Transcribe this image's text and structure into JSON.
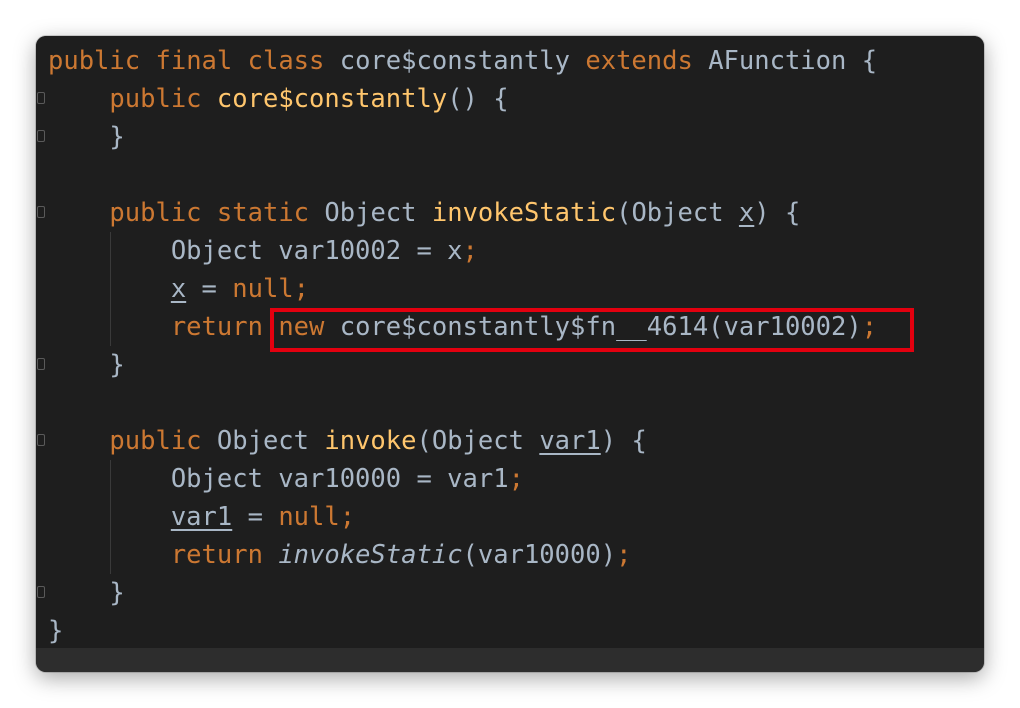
{
  "editor": {
    "lines": [
      [
        {
          "t": "public",
          "c": "kw"
        },
        {
          "t": " "
        },
        {
          "t": "final",
          "c": "kw"
        },
        {
          "t": " "
        },
        {
          "t": "class",
          "c": "kw"
        },
        {
          "t": " core$constantly "
        },
        {
          "t": "extends",
          "c": "kw"
        },
        {
          "t": " AFunction {"
        }
      ],
      [
        {
          "t": "    "
        },
        {
          "t": "public",
          "c": "kw"
        },
        {
          "t": " "
        },
        {
          "t": "core$constantly",
          "c": "fn"
        },
        {
          "t": "() {"
        }
      ],
      [
        {
          "t": "    }"
        }
      ],
      [],
      [
        {
          "t": "    "
        },
        {
          "t": "public",
          "c": "kw"
        },
        {
          "t": " "
        },
        {
          "t": "static",
          "c": "kw"
        },
        {
          "t": " Object "
        },
        {
          "t": "invokeStatic",
          "c": "fn"
        },
        {
          "t": "(Object "
        },
        {
          "t": "x",
          "c": "ul"
        },
        {
          "t": ") {"
        }
      ],
      [
        {
          "t": "        Object var10002 = x"
        },
        {
          "t": ";",
          "c": "kw"
        }
      ],
      [
        {
          "t": "        "
        },
        {
          "t": "x",
          "c": "ul"
        },
        {
          "t": " = "
        },
        {
          "t": "null",
          "c": "kw"
        },
        {
          "t": ";",
          "c": "kw"
        }
      ],
      [
        {
          "t": "        "
        },
        {
          "t": "return",
          "c": "kw"
        },
        {
          "t": " "
        },
        {
          "t": "new",
          "c": "kw"
        },
        {
          "t": " core$constantly$fn__4614(var10002)"
        },
        {
          "t": ";",
          "c": "kw"
        }
      ],
      [
        {
          "t": "    }"
        }
      ],
      [],
      [
        {
          "t": "    "
        },
        {
          "t": "public",
          "c": "kw"
        },
        {
          "t": " Object "
        },
        {
          "t": "invoke",
          "c": "fn"
        },
        {
          "t": "(Object "
        },
        {
          "t": "var1",
          "c": "ul"
        },
        {
          "t": ") {"
        }
      ],
      [
        {
          "t": "        Object var10000 = var1"
        },
        {
          "t": ";",
          "c": "kw"
        }
      ],
      [
        {
          "t": "        "
        },
        {
          "t": "var1",
          "c": "ul"
        },
        {
          "t": " = "
        },
        {
          "t": "null",
          "c": "kw"
        },
        {
          "t": ";",
          "c": "kw"
        }
      ],
      [
        {
          "t": "        "
        },
        {
          "t": "return",
          "c": "kw"
        },
        {
          "t": " "
        },
        {
          "t": "invokeStatic",
          "c": "it"
        },
        {
          "t": "(var10000)"
        },
        {
          "t": ";",
          "c": "kw"
        }
      ],
      [
        {
          "t": "    }"
        }
      ],
      [
        {
          "t": "}"
        }
      ]
    ]
  },
  "colors": {
    "background": "#1e1e1e",
    "default_text": "#a9b7c6",
    "keyword": "#cc7832",
    "method_declaration": "#ffc66d",
    "highlight_box": "#e3000f"
  }
}
